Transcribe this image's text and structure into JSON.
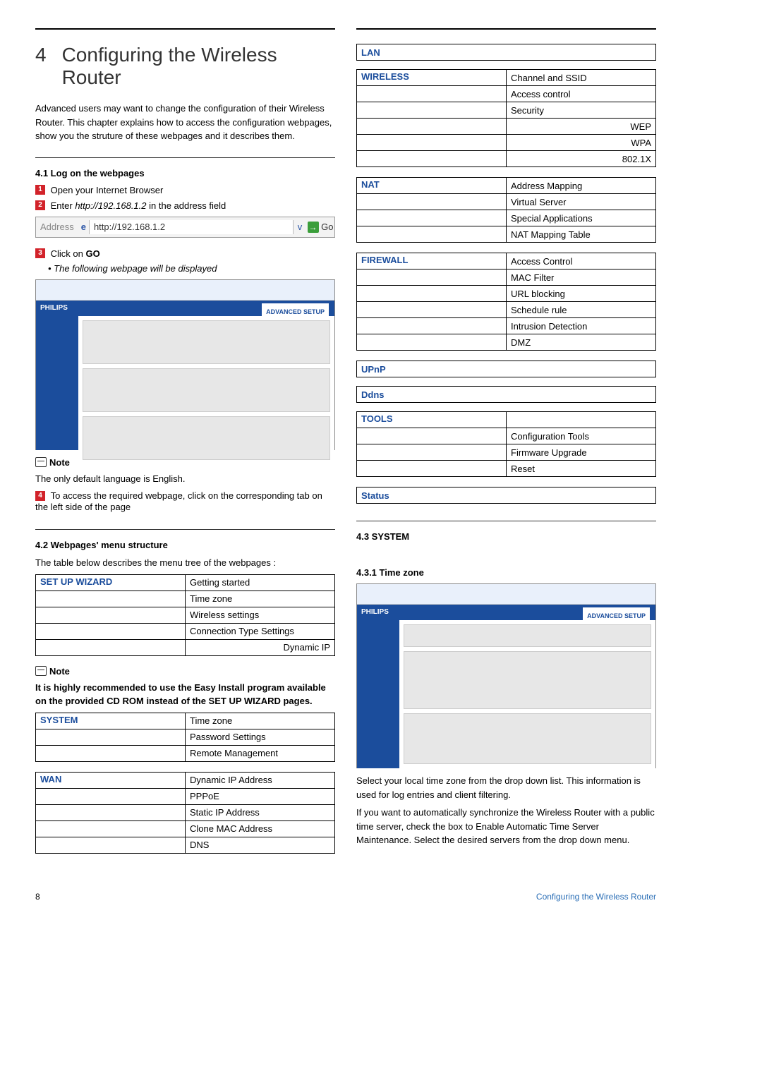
{
  "chapter": {
    "number": "4",
    "title": "Configuring the Wireless Router"
  },
  "intro": "Advanced users may want to change the configuration of their Wireless Router. This chapter explains how to access the configuration webpages, show you the struture of these webpages and it describes them.",
  "sec41": {
    "heading": "4.1   Log on the webpages",
    "steps": {
      "s1": "Open your Internet Browser",
      "s2_pre": "Enter ",
      "s2_url_italic": "http://192.168.1.2",
      "s2_post": " in the address field",
      "s3_pre": "Click on ",
      "s3_bold": "GO",
      "s3_sub": "The following webpage will be displayed",
      "s4": "To access the required webpage, click on the corresponding tab on the left side of the page"
    },
    "addressbar": {
      "label": "Address",
      "url": "http://192.168.1.2",
      "go": "Go"
    },
    "note_label": "Note",
    "note_text": "The only default language is English."
  },
  "sec42": {
    "heading": "4.2   Webpages' menu structure",
    "lead": "The table below describes the menu tree of the webpages :",
    "note_label": "Note",
    "note_text_bold": "It is highly recommended to use the Easy Install program available on the provided CD ROM instead of the SET UP WIZARD pages."
  },
  "menu": {
    "setup_wizard": {
      "name": "Set Up Wizard",
      "items": [
        "Getting started",
        "Time zone",
        "Wireless settings",
        "Connection Type Settings"
      ],
      "sub_right": "Dynamic IP"
    },
    "system": {
      "name": "System",
      "items": [
        "Time zone",
        "Password Settings",
        "Remote Management"
      ]
    },
    "wan": {
      "name": "WAN",
      "items": [
        "Dynamic IP Address",
        "PPPoE",
        "Static IP Address",
        "Clone MAC Address",
        "DNS"
      ]
    },
    "lan": {
      "name": "LAN"
    },
    "wireless": {
      "name": "Wireless",
      "items": [
        "Channel and SSID",
        "Access control",
        "Security"
      ],
      "sub_right": [
        "WEP",
        "WPA",
        "802.1X"
      ]
    },
    "nat": {
      "name": "NAT",
      "items": [
        "Address Mapping",
        "Virtual Server",
        "Special Applications",
        "NAT Mapping Table"
      ]
    },
    "firewall": {
      "name": "Firewall",
      "items": [
        "Access Control",
        "MAC Filter",
        "URL blocking",
        "Schedule rule",
        "Intrusion Detection",
        "DMZ"
      ]
    },
    "upnp": {
      "name": "UPnP"
    },
    "ddns": {
      "name": "Ddns"
    },
    "tools": {
      "name": "Tools",
      "items": [
        "Configuration Tools",
        "Firmware Upgrade",
        "Reset"
      ]
    },
    "status": {
      "name": "Status"
    }
  },
  "sec43": {
    "heading": "4.3   SYSTEM",
    "sub_heading": "4.3.1   Time zone",
    "para1": "Select your local time zone from the drop down list. This information is used for log entries and client filtering.",
    "para2": "If you want to automatically synchronize the Wireless Router with a public time server, check the box to Enable Automatic Time Server Maintenance. Select the desired servers from the drop down menu."
  },
  "brand": "PHILIPS",
  "adv_setup": "ADVANCED SETUP",
  "footer": {
    "page": "8",
    "title": "Configuring the Wireless Router"
  }
}
